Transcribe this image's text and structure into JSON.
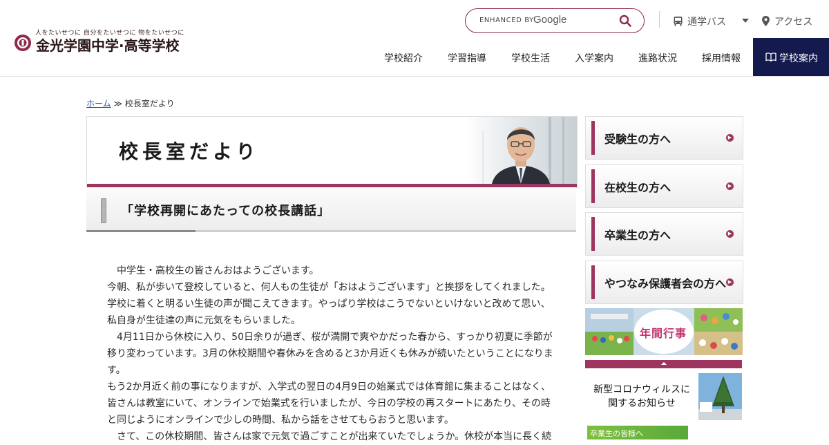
{
  "header": {
    "tagline": "人をたいせつに 自分をたいせつに 物をたいせつに",
    "school_name": "金光学園中学·高等学校",
    "search": {
      "enhanced_by": "ENHANCED BY",
      "provider": "Google"
    },
    "utility": {
      "bus": "通学バス",
      "access": "アクセス"
    },
    "nav": [
      "学校紹介",
      "学習指導",
      "学校生活",
      "入学案内",
      "進路状況",
      "採用情報"
    ],
    "cta": "学校案内"
  },
  "breadcrumb": {
    "home": "ホーム",
    "separator": "≫",
    "current": "校長室だより"
  },
  "page": {
    "title": "校長室だより",
    "subtitle": "「学校再開にあたっての校長講話」"
  },
  "article": {
    "paragraphs": [
      "　中学生・高校生の皆さんおはようございます。",
      "今朝、私が歩いて登校していると、何人もの生徒が「おはようございます」と挨拶をしてくれました。",
      "学校に着くと明るい生徒の声が聞こえてきます。やっぱり学校はこうでないといけないと改めて思い、",
      "私自身が生徒達の声に元気をもらいました。",
      "　4月11日から休校に入り、50日余りが過ぎ、桜が満開で爽やかだった春から、すっかり初夏に季節が移り変わっています。3月の休校期間や春休みを含めると3か月近くも休みが続いたということになります。",
      "もう2か月近く前の事になりますが、入学式の翌日の4月9日の始業式では体育館に集まることはなく、",
      "皆さんは教室にいて、オンラインで始業式を行いましたが、今日の学校の再スタートにあたり、その時",
      "と同じようにオンラインで少しの時間、私から話をさせてもらおうと思います。",
      "　さて、この休校期間、皆さんは家で元気で過ごすことが出来ていたでしょうか。休校が本当に長く続"
    ]
  },
  "sidebar": {
    "buttons": [
      "受験生の方へ",
      "在校生の方へ",
      "卒業生の方へ",
      "やつなみ保護者会の方へ"
    ],
    "events_banner": "年間行事",
    "covid_notice": "新型コロナウィルスに関するお知らせ",
    "graduates_banner": "卒業生の皆様へ"
  },
  "colors": {
    "accent": "#9d3560",
    "navy": "#141a4d",
    "link": "#2c4fa0"
  },
  "icons": {
    "search": "search-icon",
    "bus": "bus-icon",
    "access": "location-pin-icon",
    "book": "book-icon"
  }
}
